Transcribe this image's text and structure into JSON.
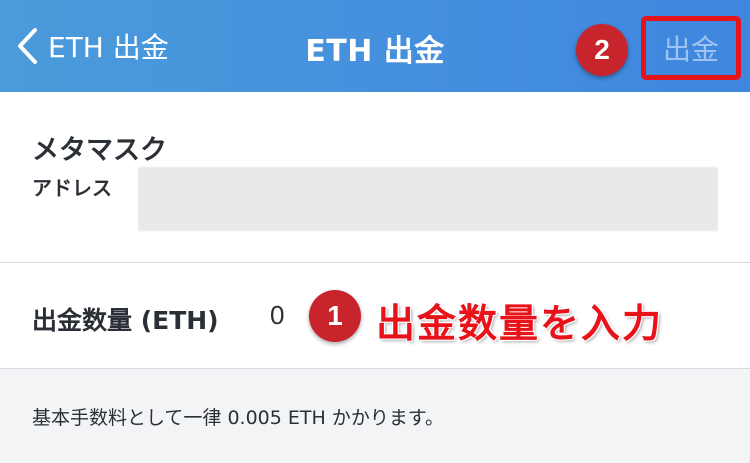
{
  "navbar": {
    "back_label": "ETH 出金",
    "title": "ETH 出金",
    "withdraw_label": "出金",
    "step_badge": "2",
    "gradient": [
      "#4b9bdb",
      "#3f86df"
    ]
  },
  "wallet": {
    "name": "メタマスク",
    "address_label": "アドレス"
  },
  "amount": {
    "label": "出金数量 (ETH)",
    "value": "0",
    "step_badge": "1",
    "annotation": "出金数量を入力"
  },
  "fee_note": "基本手数料として一律 0.005 ETH かかります。",
  "colors": {
    "highlight_red": "#e8121a",
    "badge_red": "#c8242c",
    "text": "#2b2f36",
    "background": "#f3f4f6"
  },
  "icons": {
    "back": "chevron-left-icon"
  }
}
